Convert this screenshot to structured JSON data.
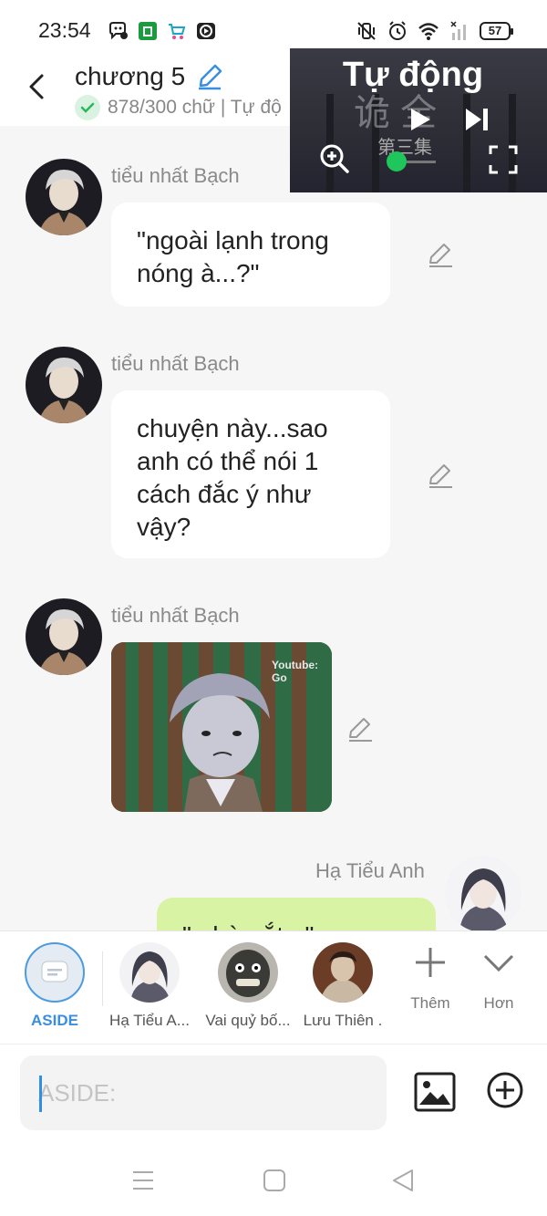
{
  "status_bar": {
    "time": "23:54",
    "battery": "57",
    "left_icons": [
      "messenger-icon",
      "shop-icon",
      "cart-icon",
      "play-box-icon"
    ],
    "right_icons": [
      "mute-vibrate-icon",
      "alarm-icon",
      "wifi-icon",
      "signal-icon",
      "battery-icon"
    ]
  },
  "header": {
    "title": "chương 5",
    "subtitle": "878/300 chữ | Tự độ"
  },
  "video_overlay": {
    "title": "Tự động",
    "background_text": "诡 全",
    "watermark": "第三集"
  },
  "messages": [
    {
      "sender": "tiểu nhất Bạch",
      "text": "\"ngoài lạnh trong nóng à...?\""
    },
    {
      "sender": "tiểu nhất Bạch",
      "text": "chuyện này...sao anh có thể nói 1 cách đắc ý như vậy?"
    },
    {
      "sender": "tiểu nhất Bạch",
      "image_caption": "Youtube: Go"
    },
    {
      "sender": "Hạ Tiểu Anh",
      "text": "\"...hà...ắt...\""
    }
  ],
  "characters": [
    {
      "label": "ASIDE"
    },
    {
      "label": "Hạ Tiểu A..."
    },
    {
      "label": "Vai quỷ bố..."
    },
    {
      "label": "Lưu Thiên ."
    }
  ],
  "actions": {
    "more_label": "Thêm",
    "less_label": "Hơn"
  },
  "input": {
    "placeholder": "ASIDE:"
  },
  "colors": {
    "accent": "#3a8ee0",
    "my_bubble": "#d8f3a3",
    "video_dot": "#1fc65b"
  }
}
